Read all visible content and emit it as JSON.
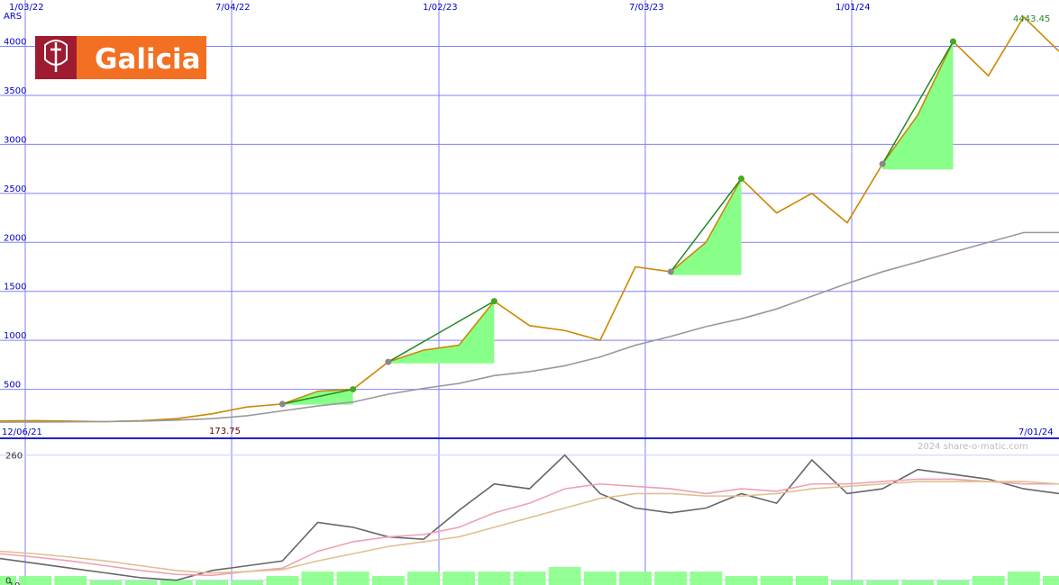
{
  "chart_data": [
    {
      "type": "line",
      "panel": "price",
      "unit": "ARS",
      "x_tick_labels": [
        "1/03/22",
        "7/04/22",
        "1/02/23",
        "7/03/23",
        "1/01/24"
      ],
      "y_tick_labels": [
        "500",
        "1000",
        "1500",
        "2000",
        "2500",
        "3000",
        "3500",
        "4000"
      ],
      "ylim": [
        0,
        4400
      ],
      "x": [
        "12/06/21",
        "1/03/22",
        "15/04/22",
        "7/06/22",
        "15/07/22",
        "1/09/22",
        "15/10/22",
        "1/12/22",
        "1/02/23",
        "15/03/23",
        "1/05/23",
        "1/06/23",
        "15/06/23",
        "7/08/23",
        "15/09/23",
        "1/10/23",
        "15/10/23",
        "1/11/23",
        "15/11/23",
        "1/12/23",
        "15/12/23",
        "1/01/24",
        "15/01/24",
        "7/02/24",
        "20/02/24",
        "15/03/24",
        "1/04/24",
        "15/04/24",
        "1/05/24",
        "1/06/24",
        "7/01/24"
      ],
      "series": [
        {
          "values": [
            178,
            180,
            175,
            170,
            180,
            200,
            250,
            320,
            350,
            480,
            500,
            780,
            900,
            950,
            1400,
            1150,
            1100,
            1000,
            1750,
            1700,
            2000,
            2650,
            2300,
            2500,
            2200,
            2800,
            3300,
            4050,
            3700,
            4300,
            3950
          ],
          "color": "#cc8800"
        },
        {
          "values": [
            165,
            166,
            168,
            170,
            175,
            185,
            200,
            230,
            280,
            330,
            370,
            450,
            510,
            560,
            640,
            680,
            740,
            830,
            950,
            1040,
            1140,
            1220,
            1320,
            1450,
            1580,
            1700,
            1800,
            1900,
            2000,
            2100,
            2100
          ],
          "color": "#999999"
        }
      ],
      "annotations": [
        "4443.45",
        "173.75",
        "12/06/21",
        "7/01/24"
      ],
      "grid": true,
      "legend": "none"
    },
    {
      "type": "line",
      "panel": "indicator",
      "y_tick_labels": [
        "260",
        "0",
        "-10"
      ],
      "ylim": [
        -10,
        280
      ],
      "watermark": "2024 share-o-matic.com",
      "series": [
        {
          "values": [
            45,
            35,
            25,
            15,
            5,
            0,
            20,
            30,
            40,
            120,
            110,
            90,
            85,
            145,
            200,
            190,
            260,
            180,
            150,
            140,
            150,
            180,
            160,
            250,
            180,
            190,
            230,
            220,
            210,
            190,
            180
          ],
          "color": "#666666"
        },
        {
          "values": [
            55,
            48,
            40,
            30,
            20,
            12,
            10,
            18,
            25,
            60,
            80,
            90,
            95,
            110,
            140,
            160,
            190,
            200,
            195,
            190,
            180,
            190,
            185,
            200,
            200,
            205,
            210,
            210,
            205,
            200,
            200
          ],
          "color": "#f0a0b0"
        },
        {
          "values": [
            60,
            55,
            48,
            40,
            30,
            20,
            15,
            18,
            22,
            40,
            55,
            70,
            80,
            90,
            110,
            130,
            150,
            170,
            180,
            180,
            175,
            175,
            180,
            190,
            195,
            200,
            205,
            205,
            205,
            205,
            200
          ],
          "color": "#e0c090"
        }
      ],
      "volume_bars": [
        2,
        2,
        2,
        1,
        1,
        1,
        1,
        1,
        2,
        3,
        3,
        2,
        3,
        3,
        3,
        3,
        4,
        3,
        3,
        3,
        3,
        2,
        2,
        2,
        1,
        1,
        1,
        1,
        2,
        3,
        2
      ],
      "grid": true,
      "legend": "none"
    }
  ],
  "logo": {
    "text": "Galicia",
    "bg": "#f36f21",
    "emblem_bg": "#9e1b32"
  },
  "colors": {
    "grid": "#8080ff",
    "price_line": "#cc8800",
    "trend": "#228822",
    "fill_up": "#88ff88",
    "fill_down": "#ffaaaa"
  }
}
